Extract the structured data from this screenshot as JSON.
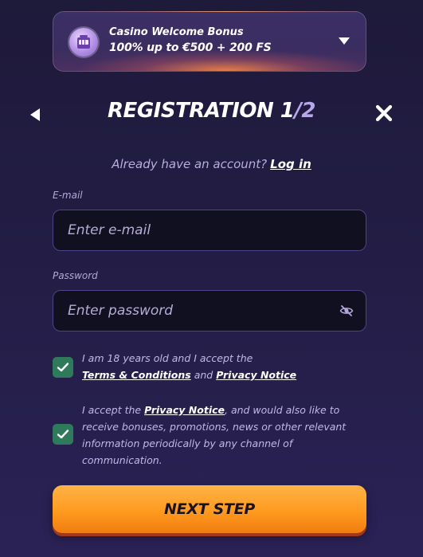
{
  "bonus": {
    "title": "Casino Welcome Bonus",
    "offer": "100% up to €500 + 200 FS",
    "icon": "slot-machine-icon"
  },
  "header": {
    "title_main": "REGISTRATION 1",
    "title_slash": "/",
    "title_total": "2",
    "back_icon": "back-arrow-icon",
    "close_icon": "close-icon"
  },
  "login_prompt": {
    "text": "Already have an account?",
    "link": "Log in"
  },
  "email": {
    "label": "E-mail",
    "placeholder": "Enter e-mail",
    "value": ""
  },
  "password": {
    "label": "Password",
    "placeholder": "Enter password",
    "value": "",
    "toggle_icon": "eye-off-icon"
  },
  "consent_terms": {
    "checked": true,
    "prefix": "I am 18 years old and I accept the",
    "terms_link": "Terms & Conditions",
    "and": "and",
    "privacy_link": "Privacy Notice"
  },
  "consent_marketing": {
    "checked": true,
    "prefix": "I accept the",
    "privacy_link": "Privacy Notice",
    "suffix": ", and would also like to receive bonuses, promotions, news or other relevant information periodically by any channel of communication."
  },
  "submit": {
    "label": "NEXT STEP"
  },
  "colors": {
    "background": "#231d45",
    "input_bg": "#111021",
    "input_border": "#4d4385",
    "checkbox": "#2f7a5a",
    "button": "#ff9a1f",
    "button_shadow": "#a2361f"
  }
}
